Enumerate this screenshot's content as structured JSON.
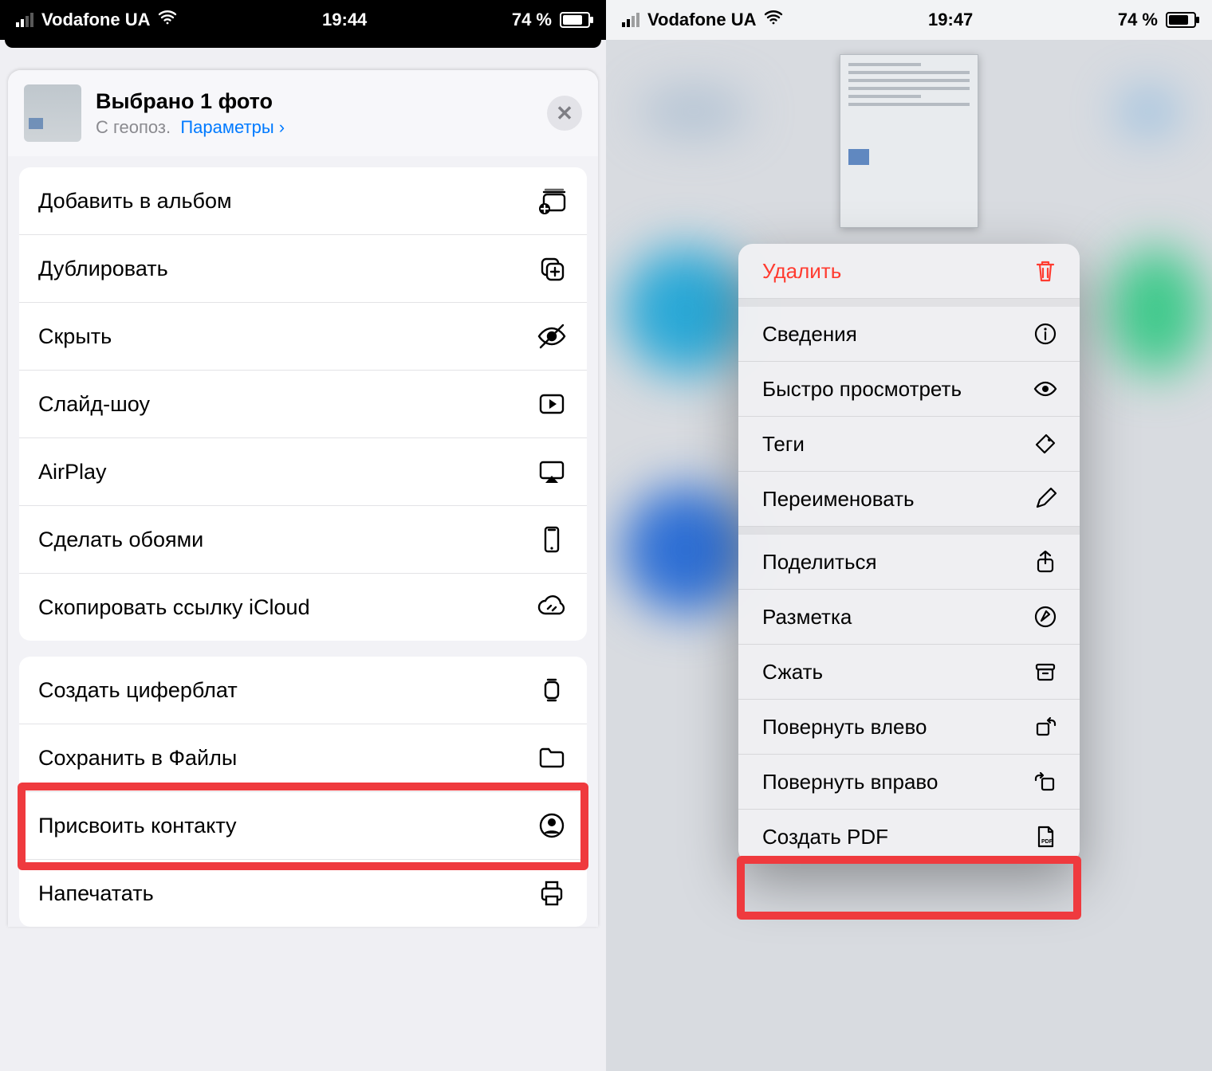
{
  "left": {
    "statusbar": {
      "carrier": "Vodafone UA",
      "time": "19:44",
      "battery": "74 %"
    },
    "header": {
      "title": "Выбрано 1 фото",
      "sub_prefix": "С геопоз.",
      "options_link": "Параметры",
      "chevron": "›"
    },
    "group1": [
      {
        "label": "Добавить в альбом",
        "icon": "add-album"
      },
      {
        "label": "Дублировать",
        "icon": "duplicate"
      },
      {
        "label": "Скрыть",
        "icon": "hide"
      },
      {
        "label": "Слайд-шоу",
        "icon": "slideshow"
      },
      {
        "label": "AirPlay",
        "icon": "airplay"
      },
      {
        "label": "Сделать обоями",
        "icon": "wallpaper"
      },
      {
        "label": "Скопировать ссылку iCloud",
        "icon": "icloud-link"
      }
    ],
    "group2": [
      {
        "label": "Создать циферблат",
        "icon": "watchface"
      },
      {
        "label": "Сохранить в Файлы",
        "icon": "folder",
        "highlight": true
      },
      {
        "label": "Присвоить контакту",
        "icon": "contact"
      },
      {
        "label": "Напечатать",
        "icon": "print"
      }
    ]
  },
  "right": {
    "statusbar": {
      "carrier": "Vodafone UA",
      "time": "19:47",
      "battery": "74 %"
    },
    "menu": {
      "group1": [
        {
          "label": "Удалить",
          "icon": "trash",
          "danger": true
        }
      ],
      "group2": [
        {
          "label": "Сведения",
          "icon": "info"
        },
        {
          "label": "Быстро просмотреть",
          "icon": "quicklook"
        },
        {
          "label": "Теги",
          "icon": "tags"
        },
        {
          "label": "Переименовать",
          "icon": "rename"
        }
      ],
      "group3": [
        {
          "label": "Поделиться",
          "icon": "share"
        },
        {
          "label": "Разметка",
          "icon": "markup"
        },
        {
          "label": "Сжать",
          "icon": "compress"
        },
        {
          "label": "Повернуть влево",
          "icon": "rotate-left"
        },
        {
          "label": "Повернуть вправо",
          "icon": "rotate-right"
        },
        {
          "label": "Создать PDF",
          "icon": "pdf",
          "highlight": true
        }
      ]
    }
  }
}
